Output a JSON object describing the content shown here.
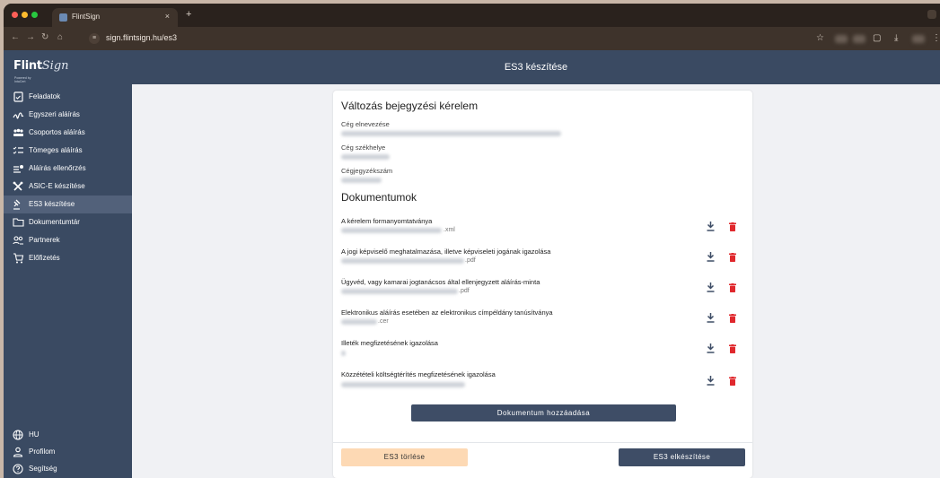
{
  "browser": {
    "tab_title": "FlintSign",
    "tab_close": "×",
    "new_tab": "+",
    "url": "sign.flintsign.hu/es3"
  },
  "sidebar": {
    "logo_main": "Flint",
    "logo_script": "Sign",
    "logo_sub": "Powered by IntaCert",
    "items": [
      {
        "label": "Feladatok",
        "icon": "task-icon"
      },
      {
        "label": "Egyszeri aláírás",
        "icon": "signature-icon"
      },
      {
        "label": "Csoportos aláírás",
        "icon": "group-icon"
      },
      {
        "label": "Tömeges aláírás",
        "icon": "bulk-list-icon"
      },
      {
        "label": "Aláírás ellenőrzés",
        "icon": "verify-icon"
      },
      {
        "label": "ASIC-E készítése",
        "icon": "tools-icon"
      },
      {
        "label": "ES3 készítése",
        "icon": "gavel-icon"
      },
      {
        "label": "Dokumentumtár",
        "icon": "folder-icon"
      },
      {
        "label": "Partnerek",
        "icon": "partners-icon"
      },
      {
        "label": "Előfizetés",
        "icon": "cart-icon"
      }
    ],
    "bottom_items": [
      {
        "label": "HU",
        "icon": "globe-icon"
      },
      {
        "label": "Profilom",
        "icon": "user-icon"
      },
      {
        "label": "Segítség",
        "icon": "help-icon"
      }
    ]
  },
  "header": {
    "title": "ES3 készítése"
  },
  "form": {
    "title": "Változás bejegyzési kérelem",
    "company_name_label": "Cég elnevezése",
    "company_seat_label": "Cég székhelye",
    "company_reg_label": "Cégjegyzékszám"
  },
  "documents": {
    "title": "Dokumentumok",
    "items": [
      {
        "title": "A kérelem formanyomtatványa",
        "ext": ".xml"
      },
      {
        "title": "A jogi képviselő meghatalmazása, illetve képviseleti jogának igazolása",
        "ext": ".pdf"
      },
      {
        "title": "Ügyvéd, vagy kamarai jogtanácsos által ellenjegyzett aláírás-minta",
        "ext": ".pdf"
      },
      {
        "title": "Elektronikus aláírás esetében az elektronikus címpéldány tanúsítványa",
        "ext": ".cer"
      },
      {
        "title": "Illeték megfizetésének igazolása",
        "ext": ""
      },
      {
        "title": "Közzétételi költségtérítés megfizetésének igazolása",
        "ext": ""
      }
    ]
  },
  "actions": {
    "add_document": "Dokumentum hozzáadása",
    "delete_es3": "ES3 törlése",
    "create_es3": "ES3 elkészítése"
  },
  "colors": {
    "sidebar_bg": "#3a4a62",
    "primary_button": "#3e4d66",
    "danger_icon": "#e0282d",
    "delete_button_bg": "#fdd9b4"
  }
}
